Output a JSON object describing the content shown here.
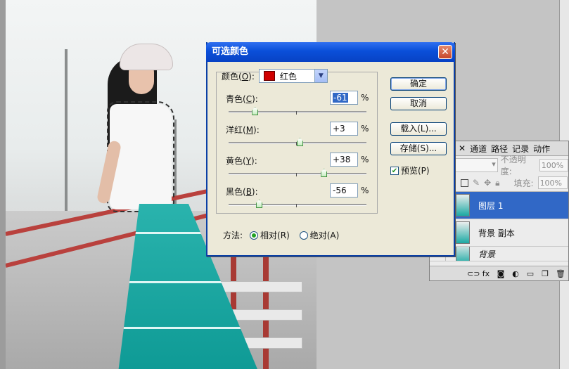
{
  "dialog": {
    "title": "可选颜色",
    "close_label": "✕",
    "colors_label": "颜色(C):",
    "colors_label_prefix": "颜色(",
    "colors_label_key": "O",
    "colors_label_suffix": "):",
    "colors_value": "红色",
    "swatch_color": "#d00000",
    "sliders": [
      {
        "label_prefix": "青色(",
        "key": "C",
        "label_suffix": "):",
        "value": "-61",
        "percent": "%",
        "position": 0.19,
        "selected": true
      },
      {
        "label_prefix": "洋红(",
        "key": "M",
        "label_suffix": "):",
        "value": "+3",
        "percent": "%",
        "position": 0.515,
        "selected": false
      },
      {
        "label_prefix": "黄色(",
        "key": "Y",
        "label_suffix": "):",
        "value": "+38",
        "percent": "%",
        "position": 0.69,
        "selected": false
      },
      {
        "label_prefix": "黑色(",
        "key": "B",
        "label_suffix": "):",
        "value": "-56",
        "percent": "%",
        "position": 0.22,
        "selected": false
      }
    ],
    "buttons": {
      "ok": "确定",
      "cancel": "取消",
      "load": "载入(L)...",
      "save": "存储(S)..."
    },
    "preview_label": "预览(P)",
    "preview_checked": true,
    "method_label": "方法:",
    "method_relative": "相对(R)",
    "method_absolute": "绝对(A)",
    "method_selected": "relative"
  },
  "layers_panel": {
    "tabs": [
      "通道",
      "路径",
      "记录",
      "动作"
    ],
    "opacity_label": "不透明度:",
    "opacity_value": "100%",
    "fill_label": "填充:",
    "fill_value": "100%",
    "layers": [
      {
        "name": "图层 1",
        "active": true
      },
      {
        "name": "背景 副本",
        "active": false
      },
      {
        "name": "背景",
        "active": false
      }
    ],
    "accent_color": "#3168c6"
  }
}
